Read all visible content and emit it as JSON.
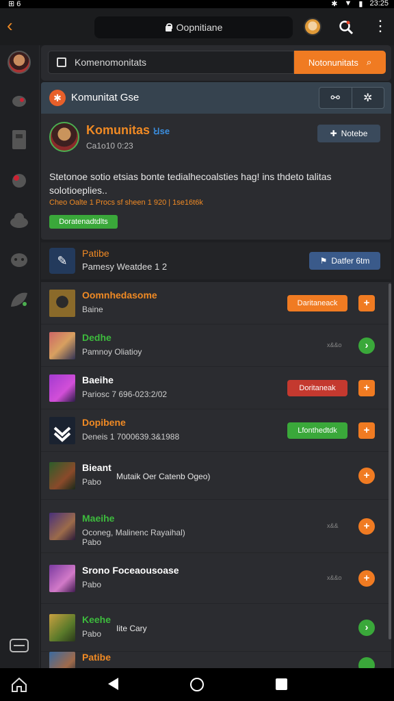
{
  "status": {
    "left": "⊞ 6",
    "time": "23:25"
  },
  "topbar": {
    "url": "Oopnitiane"
  },
  "search": {
    "placeholder": "Komenomonitats",
    "button_label": "Notonunitats"
  },
  "community": {
    "header_title": "Komunitat Gse",
    "name": "Komunitas",
    "tag": "Ꞟse",
    "date": "Ca1o10 0:23",
    "follow_label": "Notebe",
    "description": "Stetonoe sotio etsias bonte tedialhecoalsties hag! ins thdeto talitas solotioeplies..",
    "meta": "Cheo Oalte 1 Procs sf sheen 1 920 | 1se16t6k",
    "pill_label": "Doratenadtdlts"
  },
  "pinned": {
    "title": "Patibe",
    "subtitle": "Pamesy Weatdee 1 2",
    "button_label": "Datfer 6tm"
  },
  "rows": [
    {
      "title": "Oomnhedasome",
      "title_color": "#f08a24",
      "sub": "Baine",
      "badge": "Daritaneack",
      "badge_color": "#f07b22",
      "action": "+",
      "action_color": "#f07b22"
    },
    {
      "title": "Dedhe",
      "title_color": "#3dbb3d",
      "sub": "Pamnoy Oliatioy",
      "badge": "",
      "dim": "x&&o",
      "action": "›",
      "action_color": "#3aa83a"
    },
    {
      "title": "Baeihe",
      "title_color": "#ffffff",
      "sub": "Pariosc 7 696-023:2/02",
      "badge": "Doritaneak",
      "badge_color": "#c4392f",
      "action": "+",
      "action_color": "#f07b22"
    },
    {
      "title": "Dopibene",
      "title_color": "#f08a24",
      "sub": "Deneis 1 7000639.3&1988",
      "badge": "Lfonthedtdk",
      "badge_color": "#3aa83a",
      "action": "+",
      "action_color": "#f07b22"
    },
    {
      "title": "Bieant",
      "title_color": "#ffffff",
      "sub": "Pabo",
      "sub2": "Mutaik Oer Catenb Ogeo)",
      "badge": "",
      "action": "+",
      "action_color": "#f07b22"
    },
    {
      "title": "Maeihe",
      "title_color": "#3dbb3d",
      "sub": "Oconeg, Malinenc Rayaihal)",
      "sub_extra": "Pabo",
      "badge": "",
      "dim": "x&&",
      "action": "+",
      "action_color": "#f07b22"
    },
    {
      "title": "Srono Foceaousoase",
      "title_color": "#ffffff",
      "sub": "Pabo",
      "badge": "",
      "dim": "x&&o",
      "action": "+",
      "action_color": "#f07b22"
    },
    {
      "title": "Keehe",
      "title_color": "#3dbb3d",
      "sub": "Pabo",
      "sub2": "Iite Cary",
      "badge": "",
      "action": "›",
      "action_color": "#3aa83a"
    },
    {
      "title": "Patibe",
      "title_color": "#f08a24",
      "sub": "",
      "badge": "",
      "action": "",
      "action_color": "#3aa83a"
    }
  ]
}
